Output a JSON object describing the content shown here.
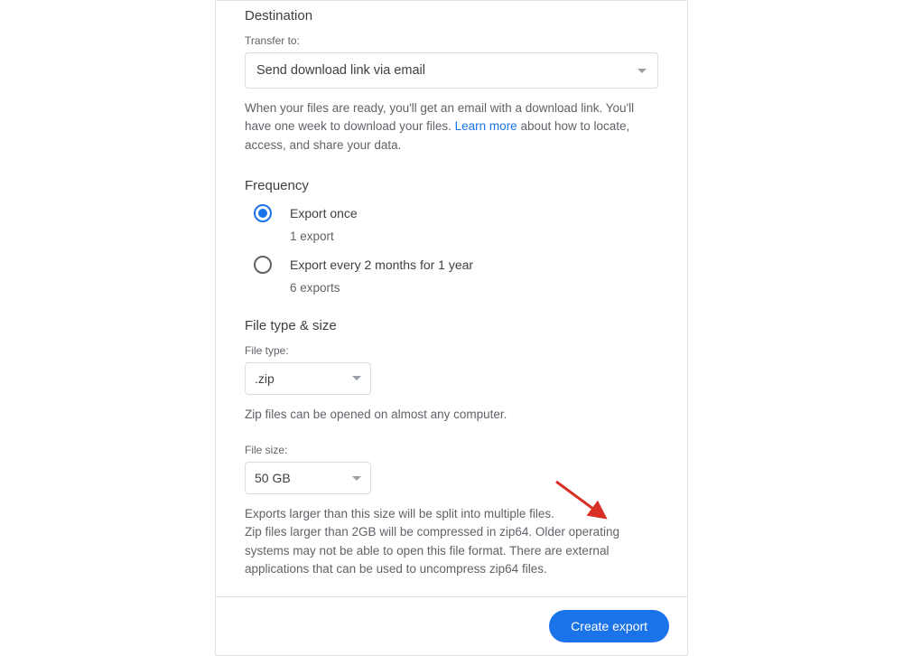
{
  "destination": {
    "title": "Destination",
    "transfer_to_label": "Transfer to:",
    "transfer_to_value": "Send download link via email",
    "help_text_before": "When your files are ready, you'll get an email with a download link. You'll have one week to download your files. ",
    "learn_more": "Learn more",
    "help_text_after": " about how to locate, access, and share your data."
  },
  "frequency": {
    "title": "Frequency",
    "options": [
      {
        "label": "Export once",
        "sub": "1 export",
        "selected": true
      },
      {
        "label": "Export every 2 months for 1 year",
        "sub": "6 exports",
        "selected": false
      }
    ]
  },
  "filetype": {
    "title": "File type & size",
    "file_type_label": "File type:",
    "file_type_value": ".zip",
    "file_type_help": "Zip files can be opened on almost any computer.",
    "file_size_label": "File size:",
    "file_size_value": "50 GB",
    "size_help_line1": "Exports larger than this size will be split into multiple files.",
    "size_help_line2": "Zip files larger than 2GB will be compressed in zip64. Older operating systems may not be able to open this file format. There are external applications that can be used to uncompress zip64 files."
  },
  "footer": {
    "create_button": "Create export"
  }
}
